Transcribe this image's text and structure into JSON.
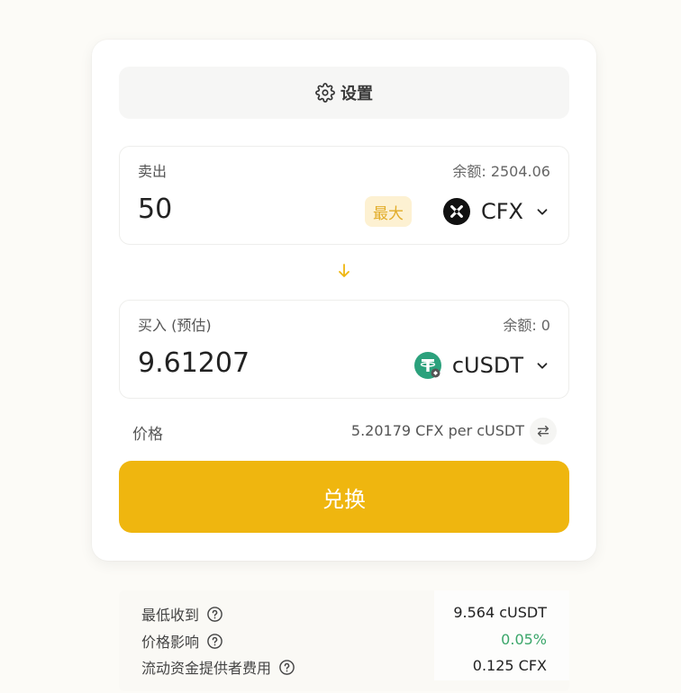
{
  "settings": {
    "label": "设置",
    "icon": "gear-icon"
  },
  "sell": {
    "label": "卖出",
    "balance": "余额: 2504.06",
    "amount": "50",
    "max_label": "最大",
    "token": "CFX",
    "token_icon": "conflux-logo-icon"
  },
  "buy": {
    "label": "买入 (预估)",
    "balance": "余额: 0",
    "amount": "9.61207",
    "token": "cUSDT",
    "token_icon": "tether-logo-icon"
  },
  "price": {
    "label": "价格",
    "value": "5.20179 CFX per cUSDT"
  },
  "swap_button": {
    "label": "兑换"
  },
  "details": {
    "min_received": {
      "label": "最低收到",
      "value": "9.564 cUSDT"
    },
    "price_impact": {
      "label": "价格影响",
      "value": "0.05%"
    },
    "lp_fee": {
      "label": "流动资金提供者费用",
      "value": "0.125 CFX"
    }
  },
  "colors": {
    "accent": "#efb60f",
    "max_bg": "#fdf1d2",
    "positive": "#3aa66a",
    "usdt_green": "#2ba17c"
  }
}
